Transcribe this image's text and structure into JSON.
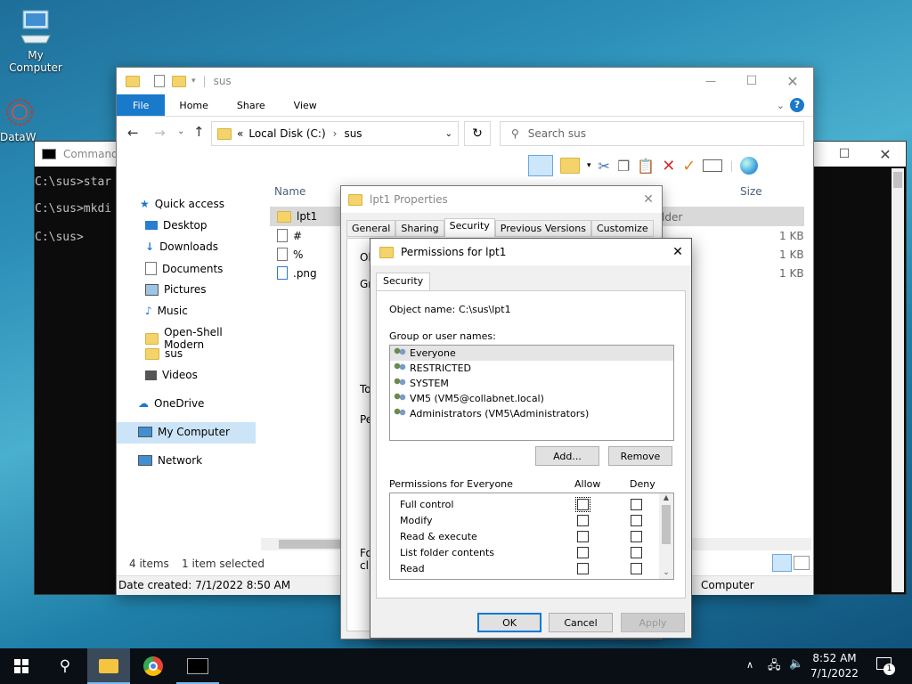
{
  "desktop": {
    "my_computer": "My Computer",
    "dataw": "DataW"
  },
  "cmd": {
    "title": "Command",
    "lines": [
      "C:\\sus>star",
      "C:\\sus>mkdi",
      "C:\\sus>"
    ]
  },
  "explorer": {
    "title": "sus",
    "tabs": [
      "File",
      "Home",
      "Share",
      "View"
    ],
    "breadcrumb": [
      "Local Disk (C:)",
      "sus"
    ],
    "breadcrumb_sep": "«",
    "search_placeholder": "Search sus",
    "columns": {
      "name": "Name",
      "size": "Size"
    },
    "nav": [
      "Quick access",
      "Desktop",
      "Downloads",
      "Documents",
      "Pictures",
      "Music",
      "Open-Shell Modern",
      "sus",
      "Videos",
      "OneDrive",
      "My Computer",
      "Network"
    ],
    "files": [
      {
        "name": "lpt1",
        "size": "",
        "type_partial": "lder"
      },
      {
        "name": "#",
        "size": "1 KB"
      },
      {
        "name": "%",
        "size": "1 KB"
      },
      {
        "name": ".png",
        "size": "1 KB"
      }
    ],
    "status_left": "4 items",
    "status_sel": "1 item selected",
    "date_created": "Date created: 7/1/2022 8:50 AM",
    "computer_label": "Computer"
  },
  "props": {
    "title": "lpt1 Properties",
    "tabs": [
      "General",
      "Sharing",
      "Security",
      "Previous Versions",
      "Customize"
    ],
    "partial": [
      "Ob",
      "Gro",
      "To",
      "Pe",
      "Fo",
      "clic"
    ]
  },
  "perm": {
    "title": "Permissions for lpt1",
    "tab": "Security",
    "object_label": "Object name:",
    "object_value": "C:\\sus\\lpt1",
    "group_label": "Group or user names:",
    "users": [
      "Everyone",
      "RESTRICTED",
      "SYSTEM",
      "VM5 (VM5@collabnet.local)",
      "Administrators (VM5\\Administrators)"
    ],
    "add": "Add...",
    "remove": "Remove",
    "perm_header": "Permissions for Everyone",
    "allow": "Allow",
    "deny": "Deny",
    "perms": [
      "Full control",
      "Modify",
      "Read & execute",
      "List folder contents",
      "Read"
    ],
    "ok": "OK",
    "cancel": "Cancel",
    "apply": "Apply"
  },
  "taskbar": {
    "time": "8:52 AM",
    "date": "7/1/2022",
    "notif_count": "1"
  }
}
